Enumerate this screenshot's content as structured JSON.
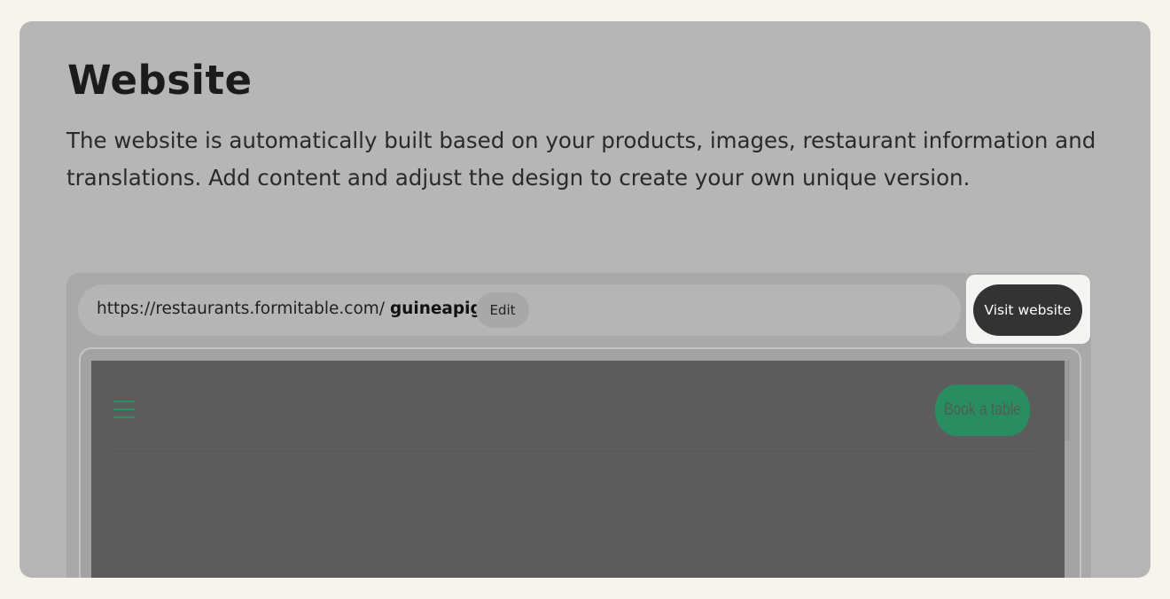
{
  "header": {
    "title": "Website",
    "description": "The website is automatically built based on your products, images, restaurant information and translations. Add content and adjust the design to create your own unique version."
  },
  "url_bar": {
    "base_url": "https://restaurants.formitable.com/",
    "slug": "guineapig",
    "edit_label": "Edit"
  },
  "actions": {
    "visit_label": "Visit website"
  },
  "site_preview": {
    "book_label": "Book a table",
    "accent_color": "#2a8d61",
    "menu_icon": "hamburger-icon"
  },
  "colors": {
    "page_background": "#f7f4ee",
    "overlay": "#b6b6b6",
    "dark_button": "#333333"
  }
}
